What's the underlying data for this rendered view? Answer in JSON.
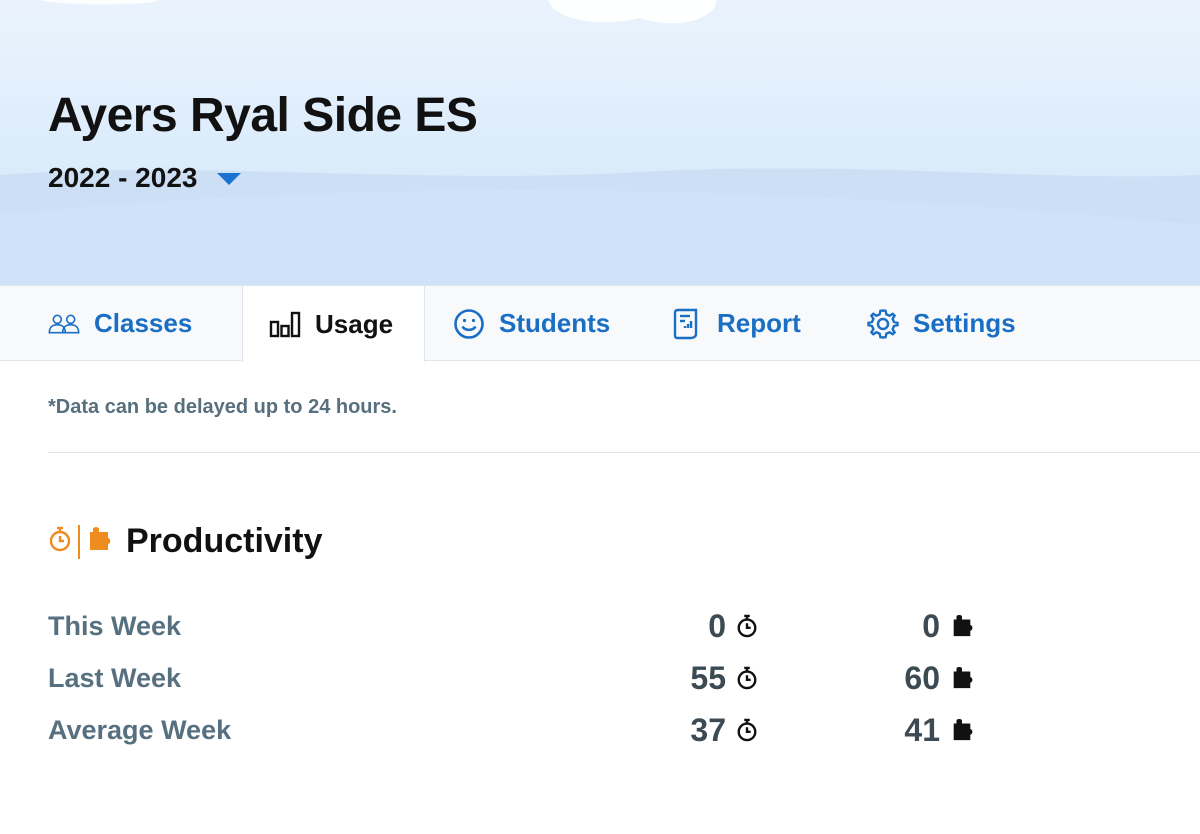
{
  "header": {
    "school_name": "Ayers Ryal Side ES",
    "school_year": "2022 - 2023"
  },
  "tabs": [
    {
      "label": "Classes",
      "icon": "people-icon",
      "active": false
    },
    {
      "label": "Usage",
      "icon": "bar-chart-icon",
      "active": true
    },
    {
      "label": "Students",
      "icon": "smiley-icon",
      "active": false
    },
    {
      "label": "Report",
      "icon": "report-icon",
      "active": false
    },
    {
      "label": "Settings",
      "icon": "gear-icon",
      "active": false
    }
  ],
  "note": "*Data can be delayed up to 24 hours.",
  "productivity": {
    "title": "Productivity",
    "rows": [
      {
        "label": "This Week",
        "time": "0",
        "puzzles": "0"
      },
      {
        "label": "Last Week",
        "time": "55",
        "puzzles": "60"
      },
      {
        "label": "Average Week",
        "time": "37",
        "puzzles": "41"
      }
    ]
  },
  "colors": {
    "accent": "#1a6fc4",
    "orange": "#ee8c1f",
    "label": "#57707f",
    "value": "#3c4a53"
  }
}
